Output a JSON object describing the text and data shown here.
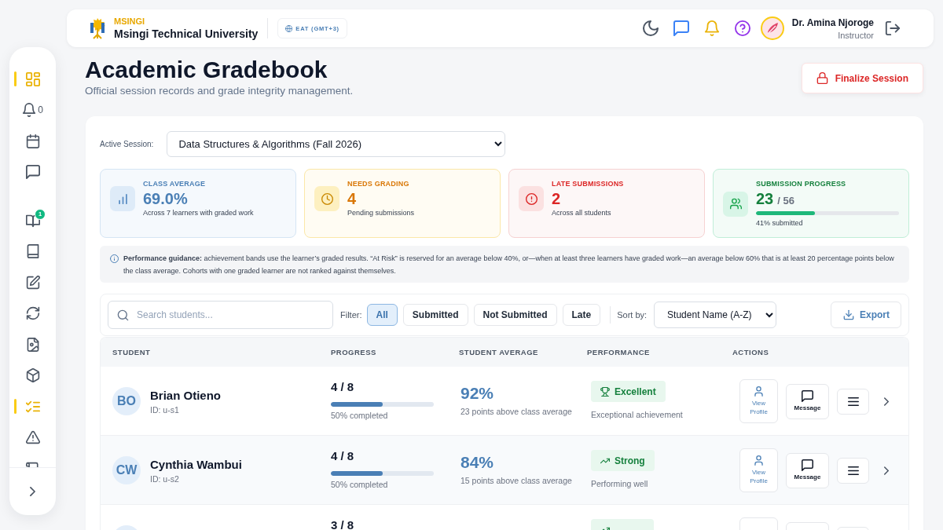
{
  "header": {
    "brand": {
      "short_name": "MSINGI",
      "name": "Msingi Technical University"
    },
    "timezone": "EAT (GMT+3)",
    "user": {
      "name": "Dr. Amina Njoroge",
      "role": "Instructor"
    }
  },
  "sidebar": {
    "sections": [
      {
        "items": [
          {
            "kind": "dashboard",
            "selected": true
          },
          {
            "kind": "bell",
            "selected": false,
            "count": "0"
          },
          {
            "kind": "calendar",
            "selected": false
          },
          {
            "kind": "chat",
            "selected": false
          }
        ]
      },
      {
        "items": [
          {
            "kind": "book_open",
            "selected": false,
            "badge": "1"
          },
          {
            "kind": "book",
            "selected": false
          },
          {
            "kind": "edit",
            "selected": false
          },
          {
            "kind": "refresh",
            "selected": false
          },
          {
            "kind": "file_image",
            "selected": false
          },
          {
            "kind": "box",
            "selected": false
          },
          {
            "kind": "checklist",
            "selected": true
          },
          {
            "kind": "alert",
            "selected": false
          },
          {
            "kind": "scroll",
            "selected": false
          }
        ]
      }
    ]
  },
  "page": {
    "title": "Academic Gradebook",
    "subtitle": "Official session records and grade integrity management.",
    "finalize_button": "Finalize Session"
  },
  "session": {
    "label": "Active Session:",
    "value": "Data Structures & Algorithms (Fall 2026)"
  },
  "stats": [
    {
      "kind": "average",
      "title": "CLASS AVERAGE",
      "value": "69.0%",
      "note": "Across 7 learners with graded work",
      "color": "#4a7fb5"
    },
    {
      "kind": "grading",
      "title": "NEEDS GRADING",
      "value": "4",
      "note": "Pending submissions",
      "color": "#d97706"
    },
    {
      "kind": "late",
      "title": "LATE SUBMISSIONS",
      "value": "2",
      "note": "Across all students",
      "color": "#dc2626"
    },
    {
      "kind": "progress",
      "title": "SUBMISSION PROGRESS",
      "value": "23",
      "total": "/ 56",
      "level": 0.41,
      "note": "41% submitted",
      "color": "#15803d"
    }
  ],
  "guidance": "**Performance guidance:** achievement bands use the learner’s graded results. “At Risk” is reserved for an average below 40%, or—when at least three learners have graded work—an average below 60% that is at least 20 percentage points below the class average. Cohorts with one graded learner are not ranked against themselves.",
  "toolbar": {
    "search": {
      "placeholder": "Search students..."
    },
    "filter_label": "Filter:",
    "filters": [
      {
        "label": "All",
        "selected": true
      },
      {
        "label": "Submitted",
        "selected": false
      },
      {
        "label": "Not Submitted",
        "selected": false
      },
      {
        "label": "Late",
        "selected": false
      }
    ],
    "sort_label": "Sort by:",
    "sort_value": "Student Name (A-Z)",
    "export_button": "Export"
  },
  "table": {
    "columns": [
      "STUDENT",
      "PROGRESS",
      "STUDENT AVERAGE",
      "PERFORMANCE",
      "ACTIONS"
    ],
    "rows": [
      {
        "initials": "BO",
        "name": "Brian Otieno",
        "id": "ID: u-s1",
        "progress": "4 / 8",
        "level": 0.5,
        "progress_note": "50% completed",
        "average": "92%",
        "average_note": "23 points above class average",
        "performance": {
          "kind": "excellent",
          "label": "Excellent",
          "note": "Exceptional achievement"
        },
        "actions": {
          "view": "View Profile",
          "message": "Message"
        }
      },
      {
        "initials": "CW",
        "name": "Cynthia Wambui",
        "id": "ID: u-s2",
        "progress": "4 / 8",
        "level": 0.5,
        "progress_note": "50% completed",
        "average": "84%",
        "average_note": "15 points above class average",
        "performance": {
          "kind": "strong",
          "label": "Strong",
          "note": "Performing well"
        },
        "actions": {
          "view": "View Profile",
          "message": "Message"
        }
      },
      {
        "progress": "3 / 8",
        "performance": {
          "kind": "strong"
        }
      }
    ]
  }
}
